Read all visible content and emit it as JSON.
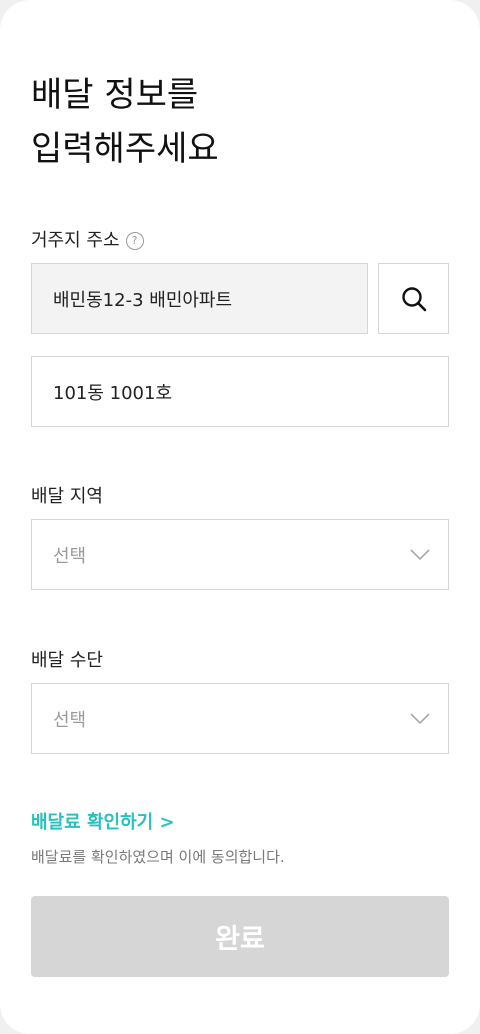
{
  "page": {
    "title_line1": "배달 정보를",
    "title_line2": "입력해주세요"
  },
  "address": {
    "label": "거주지 주소",
    "help_icon_text": "?",
    "main_value": "배민동12-3 배민아파트",
    "detail_value": "101동 1001호"
  },
  "region": {
    "label": "배달 지역",
    "placeholder": "선택"
  },
  "method": {
    "label": "배달 수단",
    "placeholder": "선택"
  },
  "fee": {
    "link_label": "배달료 확인하기 >",
    "note": "배달료를 확인하였으며 이에 동의합니다."
  },
  "submit": {
    "label": "완료"
  },
  "colors": {
    "accent": "#2ac1bc",
    "disabled_button": "#d6d6d6"
  },
  "icons": {
    "search": "search-icon",
    "help": "question-circle-icon",
    "dropdown": "chevron-down-icon"
  }
}
